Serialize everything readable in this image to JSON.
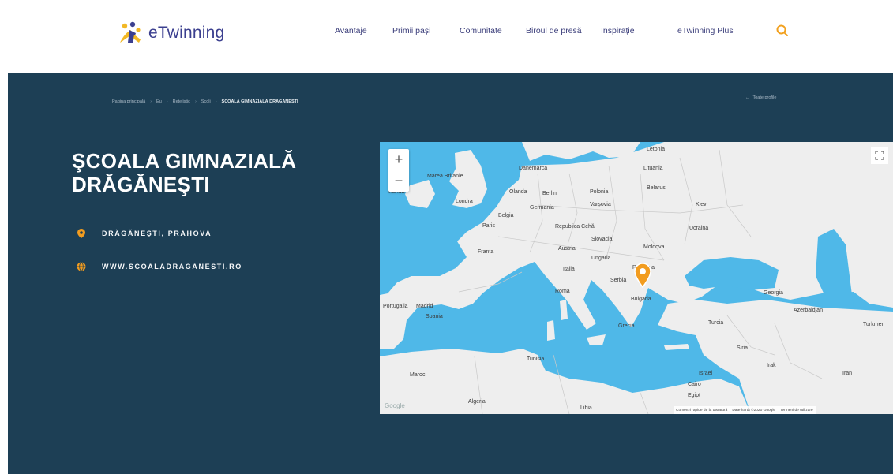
{
  "header": {
    "logo_text": "eTwinning",
    "nav": [
      "Avantaje",
      "Primii pași",
      "Comunitate",
      "Biroul de presă",
      "Inspirație",
      "eTwinning Plus"
    ],
    "search_icon": "search-icon"
  },
  "breadcrumb": [
    "Pagina principală",
    "Eu",
    "Rețelistic",
    "Școli",
    "ŞCOALA GIMNAZIALĂ DRĂGĂNEŞTI"
  ],
  "all_profiles": "Toate profile",
  "school": {
    "title": "ŞCOALA GIMNAZIALĂ DRĂGĂNEŞTI",
    "location": "DRĂGĂNEŞTI, PRAHOVA",
    "website": "WWW.SCOALADRAGANESTI.RO"
  },
  "map": {
    "zoom_in": "+",
    "zoom_out": "−",
    "labels": [
      "Letonia",
      "Danemarca",
      "Lituania",
      "Marea Britanie",
      "Irlanda",
      "Olanda",
      "Berlin",
      "Polonia",
      "Belarus",
      "Londra",
      "Germania",
      "Varșovia",
      "Kiev",
      "Belgia",
      "Paris",
      "Republica Cehă",
      "Ucraina",
      "Franța",
      "Slovacia",
      "Austria",
      "Moldova",
      "Ungaria",
      "România",
      "Serbia",
      "Italia",
      "Roma",
      "Bulgaria",
      "Portugalia",
      "Madrid",
      "Spania",
      "Grecia",
      "Turcia",
      "Georgia",
      "Azerbaidjan",
      "Turkmen",
      "Siria",
      "Irak",
      "Iran",
      "Israel",
      "Egipt",
      "Tunisia",
      "Maroc",
      "Algeria",
      "Libia",
      "Cairo"
    ],
    "attribution": [
      "Comenzi rapide de la tastatură",
      "Date hartă ©2020 Google",
      "Termeni de utilizare"
    ],
    "watermark": "Google"
  },
  "colors": {
    "hero_bg": "#1d3f55",
    "accent": "#f29c1f",
    "water": "#4fb8e8",
    "land": "#eeeeee",
    "nav_text": "#3a3d7a"
  }
}
